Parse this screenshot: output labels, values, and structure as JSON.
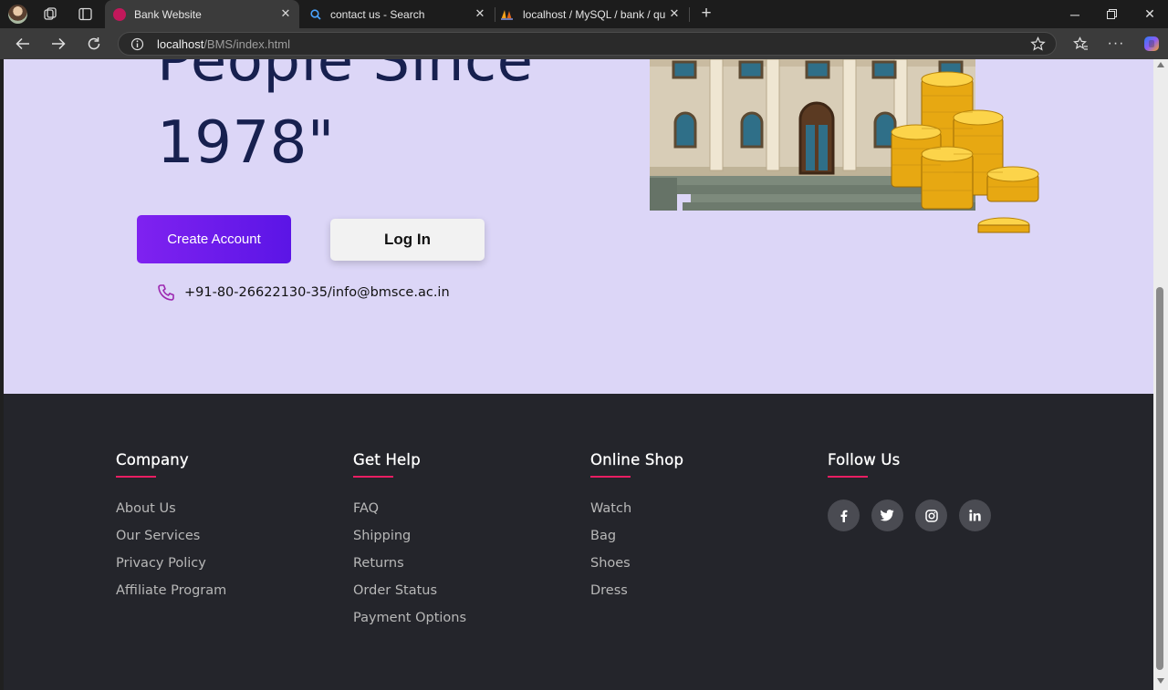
{
  "browser": {
    "tabs": [
      {
        "title": "Bank Website",
        "active": true
      },
      {
        "title": "contact us - Search",
        "active": false
      },
      {
        "title": "localhost / MySQL / bank / querie",
        "active": false
      }
    ],
    "url_host": "localhost",
    "url_path": "/BMS/index.html"
  },
  "hero": {
    "heading_line_partial": "People Since",
    "heading_line_2": "1978\"",
    "create_account_label": "Create Account",
    "login_label": "Log In",
    "contact_text": "+91-80-26622130-35/info@bmsce.ac.in",
    "accent_color": "#6a1cec"
  },
  "footer": {
    "company": {
      "heading": "Company",
      "links": [
        "About Us",
        "Our Services",
        "Privacy Policy",
        "Affiliate Program"
      ]
    },
    "help": {
      "heading": "Get Help",
      "links": [
        "FAQ",
        "Shipping",
        "Returns",
        "Order Status",
        "Payment Options"
      ]
    },
    "shop": {
      "heading": "Online Shop",
      "links": [
        "Watch",
        "Bag",
        "Shoes",
        "Dress"
      ]
    },
    "follow": {
      "heading": "Follow Us",
      "icons": [
        "facebook-icon",
        "twitter-icon",
        "instagram-icon",
        "linkedin-icon"
      ]
    },
    "underline_color": "#e91e63"
  }
}
